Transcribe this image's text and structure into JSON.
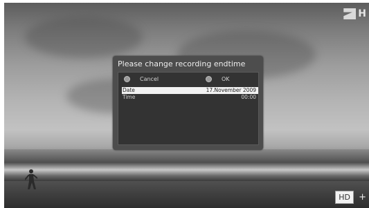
{
  "channel_logo": {
    "text": "H"
  },
  "dialog": {
    "title": "Please change recording endtime",
    "buttons": {
      "cancel": "Cancel",
      "ok": "OK"
    },
    "fields": [
      {
        "label": "Date",
        "value": "17.November 2009",
        "selected": true
      },
      {
        "label": "Time",
        "value": "00:00",
        "selected": false
      }
    ]
  },
  "status": {
    "hd_badge": "HD",
    "extra": "+"
  }
}
